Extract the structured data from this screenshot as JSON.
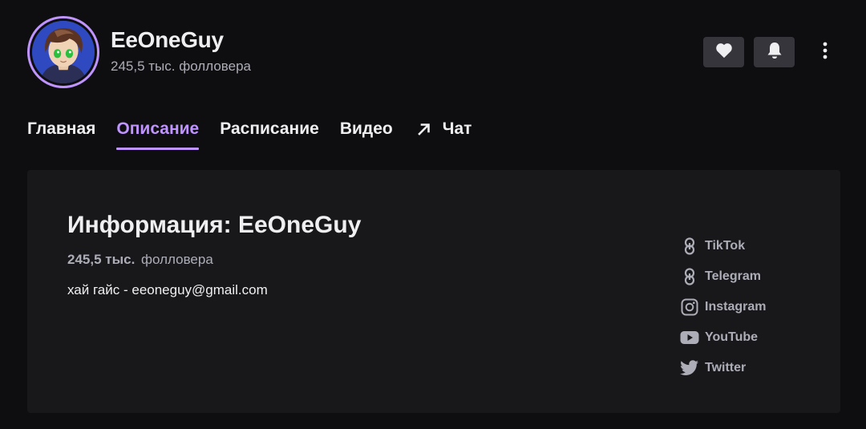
{
  "channel": {
    "name": "EeOneGuy",
    "followers_text": "245,5 тыс. фолловера"
  },
  "actions": {
    "follow_icon": "heart-icon",
    "notify_icon": "bell-icon",
    "more_icon": "more-vertical-icon"
  },
  "tabs": [
    {
      "label": "Главная",
      "active": false
    },
    {
      "label": "Описание",
      "active": true
    },
    {
      "label": "Расписание",
      "active": false
    },
    {
      "label": "Видео",
      "active": false
    },
    {
      "label": "Чат",
      "active": false,
      "icon": "external-arrow-icon"
    }
  ],
  "about": {
    "title": "Информация: EeOneGuy",
    "followers_count": "245,5 тыс.",
    "followers_label": "фолловера",
    "description": "хай гайс - eeoneguy@gmail.com"
  },
  "social_links": [
    {
      "label": "TikTok",
      "icon": "link-icon"
    },
    {
      "label": "Telegram",
      "icon": "link-icon"
    },
    {
      "label": "Instagram",
      "icon": "instagram-icon"
    },
    {
      "label": "YouTube",
      "icon": "youtube-icon"
    },
    {
      "label": "Twitter",
      "icon": "twitter-icon"
    }
  ],
  "colors": {
    "background": "#0e0e10",
    "panel": "#18181b",
    "accent": "#bf94ff",
    "text": "#efeff1",
    "muted": "#adadb8",
    "button": "#35353b"
  }
}
